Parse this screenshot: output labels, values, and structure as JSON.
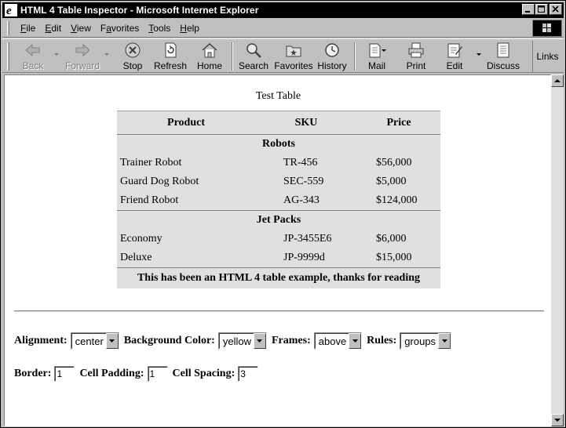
{
  "window": {
    "title": "HTML 4 Table Inspector - Microsoft Internet Explorer"
  },
  "menu": {
    "items": [
      {
        "label": "File",
        "key": "F",
        "rest": "ile"
      },
      {
        "label": "Edit",
        "key": "E",
        "rest": "dit"
      },
      {
        "label": "View",
        "key": "V",
        "rest": "iew"
      },
      {
        "label": "Favorites",
        "key": "a",
        "pre": "F",
        "rest": "vorites"
      },
      {
        "label": "Tools",
        "key": "T",
        "rest": "ools"
      },
      {
        "label": "Help",
        "key": "H",
        "rest": "elp"
      }
    ]
  },
  "toolbar": {
    "back": "Back",
    "forward": "Forward",
    "stop": "Stop",
    "refresh": "Refresh",
    "home": "Home",
    "search": "Search",
    "favorites": "Favorites",
    "history": "History",
    "mail": "Mail",
    "print": "Print",
    "edit": "Edit",
    "discuss": "Discuss",
    "links": "Links"
  },
  "page": {
    "caption": "Test Table",
    "table": {
      "headers": [
        "Product",
        "SKU",
        "Price"
      ],
      "groups": [
        {
          "name": "Robots",
          "rows": [
            [
              "Trainer Robot",
              "TR-456",
              "$56,000"
            ],
            [
              "Guard Dog Robot",
              "SEC-559",
              "$5,000"
            ],
            [
              "Friend Robot",
              "AG-343",
              "$124,000"
            ]
          ]
        },
        {
          "name": "Jet Packs",
          "rows": [
            [
              "Economy",
              "JP-3455E6",
              "$6,000"
            ],
            [
              "Deluxe",
              "JP-9999d",
              "$15,000"
            ]
          ]
        }
      ],
      "footer": "This has been an HTML 4 table example, thanks for reading"
    },
    "form": {
      "alignment_label": "Alignment:",
      "alignment_value": "center",
      "bgcolor_label": "Background Color:",
      "bgcolor_value": "yellow",
      "frames_label": "Frames:",
      "frames_value": "above",
      "rules_label": "Rules:",
      "rules_value": "groups",
      "border_label": "Border:",
      "border_value": "1",
      "padding_label": "Cell Padding:",
      "padding_value": "1",
      "spacing_label": "Cell Spacing:",
      "spacing_value": "3"
    }
  }
}
